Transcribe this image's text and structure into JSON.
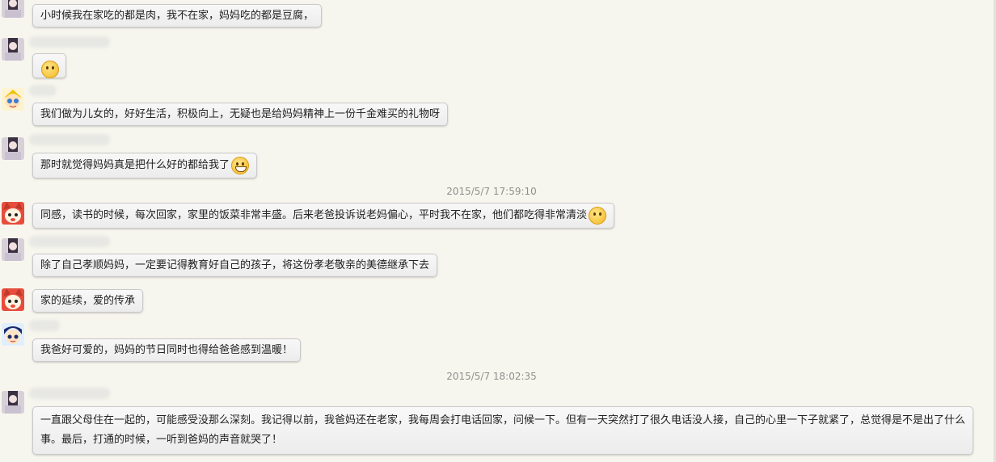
{
  "chat": {
    "timestamps": [
      "2015/5/7 17:59:10",
      "2015/5/7 18:02:35"
    ],
    "messages": [
      {
        "text": "小时候我在家吃的都是肉，我不在家，妈妈吃的都是豆腐，",
        "emoji": ""
      },
      {
        "text": "",
        "emoji": "cry-emoji"
      },
      {
        "text": "我们做为儿女的，好好生活，积极向上，无疑也是给妈妈精神上一份千金难买的礼物呀",
        "emoji": ""
      },
      {
        "text": "那时就觉得妈妈真是把什么好的都给我了",
        "emoji": "grin-emoji"
      },
      {
        "text": "同感，读书的时候，每次回家，家里的饭菜非常丰盛。后来老爸投诉说老妈偏心，平时我不在家，他们都吃得非常清淡",
        "emoji": "awkward-emoji"
      },
      {
        "text": "除了自己孝顺妈妈，一定要记得教育好自己的孩子，将这份孝老敬亲的美德继承下去",
        "emoji": ""
      },
      {
        "text": "家的延续，爱的传承",
        "emoji": ""
      },
      {
        "text": "我爸好可爱的，妈妈的节日同时也得给爸爸感到温暖！",
        "emoji": ""
      },
      {
        "text": "一直跟父母住在一起的，可能感受没那么深刻。我记得以前，我爸妈还在老家，我每周会打电话回家，问候一下。但有一天突然打了很久电话没人接，自己的心里一下子就紧了，总觉得是不是出了什么事。最后，打通的时候，一听到爸妈的声音就哭了！",
        "emoji": ""
      }
    ]
  }
}
